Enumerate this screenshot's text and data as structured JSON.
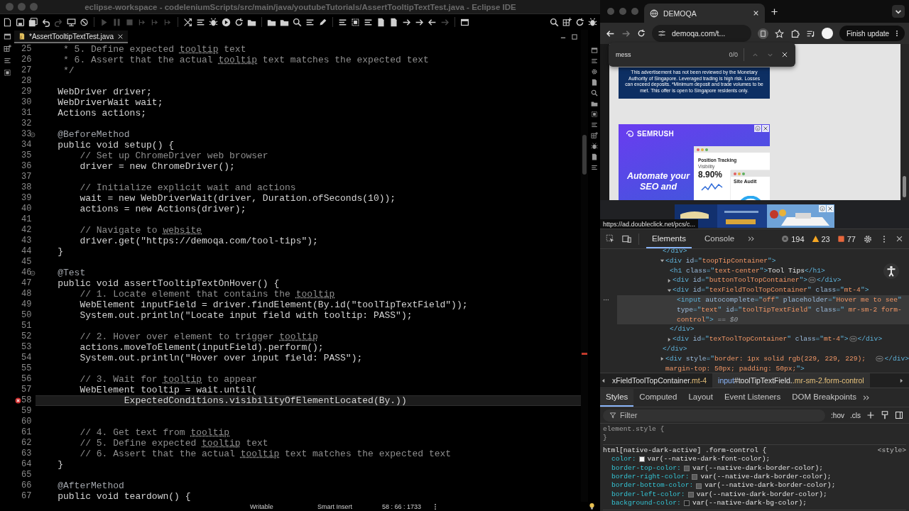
{
  "ide": {
    "title": "eclipse-workspace - codeleniumScripts/src/main/java/youtubeTutorials/AssertTooltipTextTest.java - Eclipse IDE",
    "editor_tabs": [
      {
        "label": "*AssertTooltipTextTest.java",
        "selected": true
      }
    ],
    "lines": [
      {
        "number": "25",
        "current": false,
        "error": false,
        "fold": false,
        "segments": [
          {
            "kind": "comment",
            "text": "     * 5. Define expected "
          },
          {
            "kind": "misspelled",
            "text": "tooltip"
          },
          {
            "kind": "comment",
            "text": " text"
          }
        ]
      },
      {
        "number": "26",
        "current": false,
        "error": false,
        "fold": false,
        "segments": [
          {
            "kind": "comment",
            "text": "     * 6. Assert that the actual "
          },
          {
            "kind": "misspelled",
            "text": "tooltip"
          },
          {
            "kind": "comment",
            "text": " text matches the expected text"
          }
        ]
      },
      {
        "number": "27",
        "current": false,
        "error": false,
        "fold": false,
        "segments": [
          {
            "kind": "comment",
            "text": "     */"
          }
        ]
      },
      {
        "number": "28",
        "current": false,
        "error": false,
        "fold": false
      },
      {
        "number": "29",
        "current": false,
        "error": false,
        "fold": false,
        "segments": [
          {
            "kind": "code",
            "text": "    WebDriver driver;"
          }
        ]
      },
      {
        "number": "30",
        "current": false,
        "error": false,
        "fold": false,
        "segments": [
          {
            "kind": "code",
            "text": "    WebDriverWait wait;"
          }
        ]
      },
      {
        "number": "31",
        "current": false,
        "error": false,
        "fold": false,
        "segments": [
          {
            "kind": "code",
            "text": "    Actions actions;"
          }
        ]
      },
      {
        "number": "32",
        "current": false,
        "error": false,
        "fold": false
      },
      {
        "number": "33",
        "current": false,
        "error": false,
        "fold": true,
        "segments": [
          {
            "kind": "annotation",
            "text": "    @BeforeMethod"
          }
        ]
      },
      {
        "number": "34",
        "current": false,
        "error": false,
        "fold": false,
        "segments": [
          {
            "kind": "code",
            "text": "    public void setup() {"
          }
        ]
      },
      {
        "number": "35",
        "current": false,
        "error": false,
        "fold": false,
        "segments": [
          {
            "kind": "comment",
            "text": "        // Set up ChromeDriver web browser"
          }
        ]
      },
      {
        "number": "36",
        "current": false,
        "error": false,
        "fold": false,
        "segments": [
          {
            "kind": "code",
            "text": "        driver = new ChromeDriver();"
          }
        ]
      },
      {
        "number": "37",
        "current": false,
        "error": false,
        "fold": false
      },
      {
        "number": "38",
        "current": false,
        "error": false,
        "fold": false,
        "segments": [
          {
            "kind": "comment",
            "text": "        // Initialize explicit wait and actions"
          }
        ]
      },
      {
        "number": "39",
        "current": false,
        "error": false,
        "fold": false,
        "segments": [
          {
            "kind": "code",
            "text": "        wait = new WebDriverWait(driver, Duration.ofSeconds(10));"
          }
        ]
      },
      {
        "number": "40",
        "current": false,
        "error": false,
        "fold": false,
        "segments": [
          {
            "kind": "code",
            "text": "        actions = new Actions(driver);"
          }
        ]
      },
      {
        "number": "41",
        "current": false,
        "error": false,
        "fold": false
      },
      {
        "number": "42",
        "current": false,
        "error": false,
        "fold": false,
        "segments": [
          {
            "kind": "comment",
            "text": "        // Navigate to "
          },
          {
            "kind": "misspelled",
            "text": "website"
          }
        ]
      },
      {
        "number": "43",
        "current": false,
        "error": false,
        "fold": false,
        "segments": [
          {
            "kind": "code",
            "text": "        driver.get(\"https://demoqa.com/tool-tips\");"
          }
        ]
      },
      {
        "number": "44",
        "current": false,
        "error": false,
        "fold": false,
        "segments": [
          {
            "kind": "code",
            "text": "    }"
          }
        ]
      },
      {
        "number": "45",
        "current": false,
        "error": false,
        "fold": false
      },
      {
        "number": "46",
        "current": false,
        "error": false,
        "fold": true,
        "segments": [
          {
            "kind": "annotation",
            "text": "    @Test"
          }
        ]
      },
      {
        "number": "47",
        "current": false,
        "error": false,
        "fold": false,
        "segments": [
          {
            "kind": "code",
            "text": "    public void assertTooltipTextOnHover() {"
          }
        ]
      },
      {
        "number": "48",
        "current": false,
        "error": false,
        "fold": false,
        "segments": [
          {
            "kind": "comment",
            "text": "        // 1. Locate element that contains the "
          },
          {
            "kind": "misspelled",
            "text": "tooltip"
          }
        ]
      },
      {
        "number": "49",
        "current": false,
        "error": false,
        "fold": false,
        "segments": [
          {
            "kind": "code",
            "text": "        WebElement inputField = driver.findElement(By.id(\"toolTipTextField\"));"
          }
        ]
      },
      {
        "number": "50",
        "current": false,
        "error": false,
        "fold": false,
        "segments": [
          {
            "kind": "code",
            "text": "        System.out.println(\"Locate input field with tooltip: PASS\");"
          }
        ]
      },
      {
        "number": "51",
        "current": false,
        "error": false,
        "fold": false
      },
      {
        "number": "52",
        "current": false,
        "error": false,
        "fold": false,
        "segments": [
          {
            "kind": "comment",
            "text": "        // 2. Hover over element to trigger "
          },
          {
            "kind": "misspelled",
            "text": "tooltip"
          }
        ]
      },
      {
        "number": "53",
        "current": false,
        "error": false,
        "fold": false,
        "segments": [
          {
            "kind": "code",
            "text": "        actions.moveToElement(inputField).perform();"
          }
        ]
      },
      {
        "number": "54",
        "current": false,
        "error": false,
        "fold": false,
        "segments": [
          {
            "kind": "code",
            "text": "        System.out.println(\"Hover over input field: PASS\");"
          }
        ]
      },
      {
        "number": "55",
        "current": false,
        "error": false,
        "fold": false
      },
      {
        "number": "56",
        "current": false,
        "error": false,
        "fold": false,
        "segments": [
          {
            "kind": "comment",
            "text": "        // 3. Wait for "
          },
          {
            "kind": "misspelled",
            "text": "tooltip"
          },
          {
            "kind": "comment",
            "text": " to appear"
          }
        ]
      },
      {
        "number": "57",
        "current": false,
        "error": false,
        "fold": false,
        "segments": [
          {
            "kind": "code",
            "text": "        WebElement tooltip = wait.until("
          }
        ]
      },
      {
        "number": "58",
        "current": true,
        "error": true,
        "fold": false,
        "segments": [
          {
            "kind": "code",
            "text": "                ExpectedConditions.visibilityOfElementLocated(By.))"
          }
        ]
      },
      {
        "number": "59",
        "current": false,
        "error": false,
        "fold": false
      },
      {
        "number": "60",
        "current": false,
        "error": false,
        "fold": false
      },
      {
        "number": "61",
        "current": false,
        "error": false,
        "fold": false,
        "segments": [
          {
            "kind": "comment",
            "text": "        // 4. Get text from "
          },
          {
            "kind": "misspelled",
            "text": "tooltip"
          }
        ]
      },
      {
        "number": "62",
        "current": false,
        "error": false,
        "fold": false,
        "segments": [
          {
            "kind": "comment",
            "text": "        // 5. Define expected "
          },
          {
            "kind": "misspelled",
            "text": "tooltip"
          },
          {
            "kind": "comment",
            "text": " text"
          }
        ]
      },
      {
        "number": "63",
        "current": false,
        "error": false,
        "fold": false,
        "segments": [
          {
            "kind": "comment",
            "text": "        // 6. Assert that the actual "
          },
          {
            "kind": "misspelled",
            "text": "tooltip"
          },
          {
            "kind": "comment",
            "text": " text matches the expected text"
          }
        ]
      },
      {
        "number": "64",
        "current": false,
        "error": false,
        "fold": false,
        "segments": [
          {
            "kind": "code",
            "text": "    }"
          }
        ]
      },
      {
        "number": "65",
        "current": false,
        "error": false,
        "fold": false
      },
      {
        "number": "66",
        "current": false,
        "error": false,
        "fold": false,
        "segments": [
          {
            "kind": "annotation",
            "text": "    @AfterMethod"
          }
        ]
      },
      {
        "number": "67",
        "current": false,
        "error": false,
        "fold": false,
        "segments": [
          {
            "kind": "code",
            "text": "    public void teardown() {"
          }
        ]
      }
    ],
    "status_bar": [
      "Writable",
      "Smart Insert",
      "58 : 66 : 1733"
    ]
  },
  "browser": {
    "tabs": [
      {
        "label": "DEMOQA",
        "selected": true
      }
    ],
    "url": "demoqa.com/t...",
    "update_button": "Finish update",
    "find_bar": {
      "value": "mess",
      "count": "0/0"
    },
    "disclaimer": "This advertisement has not been reviewed by the Monetary Authority of Singapore. Leveraged trading is high risk. Losses can exceed deposits.  *Minimum deposit and trade volumes to be met. This offer is open to Singapore residents only.",
    "semrush_ad": {
      "brand": "SEMRUSH",
      "headline": "Automate your SEO and",
      "card_title": "Position Tracking",
      "metric_label": "Visibility",
      "metric": "8.90%",
      "second_card": "Site Audit"
    },
    "status_url": "https://ad.doubleclick.net/pcs/c..."
  },
  "devtools": {
    "tabs": [
      {
        "label": "Elements",
        "selected": true
      },
      {
        "label": "Console",
        "selected": false
      }
    ],
    "counts": [
      {
        "kind": "error",
        "value": "194"
      },
      {
        "kind": "warning",
        "value": "23"
      },
      {
        "kind": "issue",
        "value": "77"
      }
    ],
    "dom": [
      {
        "selected": false,
        "segments": [
          {
            "kind": "tag",
            "text": "</div>"
          }
        ]
      },
      {
        "selected": false,
        "expanded": true,
        "close": "</div>",
        "segments": [
          {
            "kind": "tag",
            "text": "<div "
          },
          {
            "kind": "attr",
            "text": "id"
          },
          {
            "kind": "tag",
            "text": "=\""
          },
          {
            "kind": "value",
            "text": "toopTipContainer"
          },
          {
            "kind": "tag",
            "text": "\">"
          }
        ],
        "children": [
          {
            "selected": false,
            "segments": [
              {
                "kind": "tag",
                "text": "<h1 "
              },
              {
                "kind": "attr",
                "text": "class"
              },
              {
                "kind": "tag",
                "text": "=\""
              },
              {
                "kind": "value",
                "text": "text-center"
              },
              {
                "kind": "tag",
                "text": "\">"
              },
              {
                "kind": "text",
                "text": "Tool Tips"
              },
              {
                "kind": "tag",
                "text": "</h1>"
              }
            ]
          },
          {
            "selected": false,
            "expanded": false,
            "close": "</div>",
            "segments": [
              {
                "kind": "tag",
                "text": "<div "
              },
              {
                "kind": "attr",
                "text": "id"
              },
              {
                "kind": "tag",
                "text": "=\""
              },
              {
                "kind": "value",
                "text": "buttonToolTopContainer"
              },
              {
                "kind": "tag",
                "text": "\">"
              }
            ]
          },
          {
            "selected": false,
            "expanded": true,
            "close": "</div>",
            "segments": [
              {
                "kind": "tag",
                "text": "<div "
              },
              {
                "kind": "attr",
                "text": "id"
              },
              {
                "kind": "tag",
                "text": "=\""
              },
              {
                "kind": "value",
                "text": "texFieldToolTopContainer"
              },
              {
                "kind": "tag",
                "text": "\" "
              },
              {
                "kind": "attr",
                "text": "class"
              },
              {
                "kind": "tag",
                "text": "=\""
              },
              {
                "kind": "value",
                "text": "mt-4"
              },
              {
                "kind": "tag",
                "text": "\">"
              }
            ],
            "children": [
              {
                "selected": true,
                "segments": [
                  {
                    "kind": "tag",
                    "text": "<input "
                  },
                  {
                    "kind": "attr",
                    "text": "autocomplete"
                  },
                  {
                    "kind": "tag",
                    "text": "=\""
                  },
                  {
                    "kind": "value",
                    "text": "off"
                  },
                  {
                    "kind": "tag",
                    "text": "\" "
                  },
                  {
                    "kind": "attr",
                    "text": "placeholder"
                  },
                  {
                    "kind": "tag",
                    "text": "=\""
                  },
                  {
                    "kind": "value",
                    "text": "Hover me to see"
                  },
                  {
                    "kind": "tag",
                    "text": "\" "
                  },
                  {
                    "kind": "attr",
                    "text": "type"
                  },
                  {
                    "kind": "tag",
                    "text": "=\""
                  },
                  {
                    "kind": "value",
                    "text": "text"
                  },
                  {
                    "kind": "tag",
                    "text": "\" "
                  },
                  {
                    "kind": "attr",
                    "text": "id"
                  },
                  {
                    "kind": "tag",
                    "text": "=\""
                  },
                  {
                    "kind": "value",
                    "text": "toolTipTextField"
                  },
                  {
                    "kind": "tag",
                    "text": "\" "
                  },
                  {
                    "kind": "attr",
                    "text": "class"
                  },
                  {
                    "kind": "tag",
                    "text": "=\""
                  },
                  {
                    "kind": "value",
                    "text": " mr-sm-2 form-control"
                  },
                  {
                    "kind": "tag",
                    "text": "\">"
                  },
                  {
                    "kind": "ref",
                    "text": " == $0"
                  }
                ]
              }
            ]
          },
          {
            "selected": false,
            "expanded": false,
            "close": "</div>",
            "segments": [
              {
                "kind": "tag",
                "text": "<div "
              },
              {
                "kind": "attr",
                "text": "id"
              },
              {
                "kind": "tag",
                "text": "=\""
              },
              {
                "kind": "value",
                "text": "texToolTopContainer"
              },
              {
                "kind": "tag",
                "text": "\" "
              },
              {
                "kind": "attr",
                "text": "class"
              },
              {
                "kind": "tag",
                "text": "=\""
              },
              {
                "kind": "value",
                "text": "mt-4"
              },
              {
                "kind": "tag",
                "text": "\">"
              }
            ]
          }
        ]
      },
      {
        "selected": false,
        "expanded": false,
        "close": "</div>",
        "segments": [
          {
            "kind": "tag",
            "text": "<div "
          },
          {
            "kind": "attr",
            "text": "style"
          },
          {
            "kind": "tag",
            "text": "=\""
          },
          {
            "kind": "value",
            "text": "border: 1px solid rgb(229, 229, 229); margin-top: 50px; padding: 50px;"
          },
          {
            "kind": "tag",
            "text": "\">"
          }
        ]
      }
    ],
    "breadcrumbs": [
      {
        "selected": false,
        "segments": [
          {
            "kind": "name",
            "text": "xFieldToolTopContainer"
          },
          {
            "kind": "class",
            "text": ".mt-4"
          }
        ]
      },
      {
        "selected": true,
        "segments": [
          {
            "kind": "tag",
            "text": "input"
          },
          {
            "kind": "name",
            "text": "#toolTipTextField."
          },
          {
            "kind": "class",
            "text": ".mr-sm-2.form-control"
          }
        ]
      }
    ],
    "style_tabs": [
      {
        "label": "Styles",
        "selected": true
      },
      {
        "label": "Computed",
        "selected": false
      },
      {
        "label": "Layout",
        "selected": false
      },
      {
        "label": "Event Listeners",
        "selected": false
      },
      {
        "label": "DOM Breakpoints",
        "selected": false
      }
    ],
    "filter": {
      "placeholder": "Filter"
    },
    "state_buttons": [
      ":hov",
      ".cls"
    ],
    "rules": [
      {
        "selector": "element.style {",
        "close": "}"
      },
      {
        "selector": "html[native-dark-active] .form-control {",
        "source": "<style>",
        "declarations": [
          {
            "property": "color:",
            "value": "var(--native-dark-font-color);",
            "color": "#f2f2f2"
          },
          {
            "property": "border-top-color:",
            "value": "var(--native-dark-border-color);",
            "color": "#5a5a5a"
          },
          {
            "property": "border-right-color:",
            "value": "var(--native-dark-border-color);",
            "color": "#5a5a5a"
          },
          {
            "property": "border-bottom-color:",
            "value": "var(--native-dark-border-color);",
            "color": "#5a5a5a"
          },
          {
            "property": "border-left-color:",
            "value": "var(--native-dark-border-color);",
            "color": "#5a5a5a"
          },
          {
            "property": "background-color:",
            "value": "var(--native-dark-bg-color);",
            "color": "#1e1e1e"
          }
        ]
      }
    ]
  }
}
